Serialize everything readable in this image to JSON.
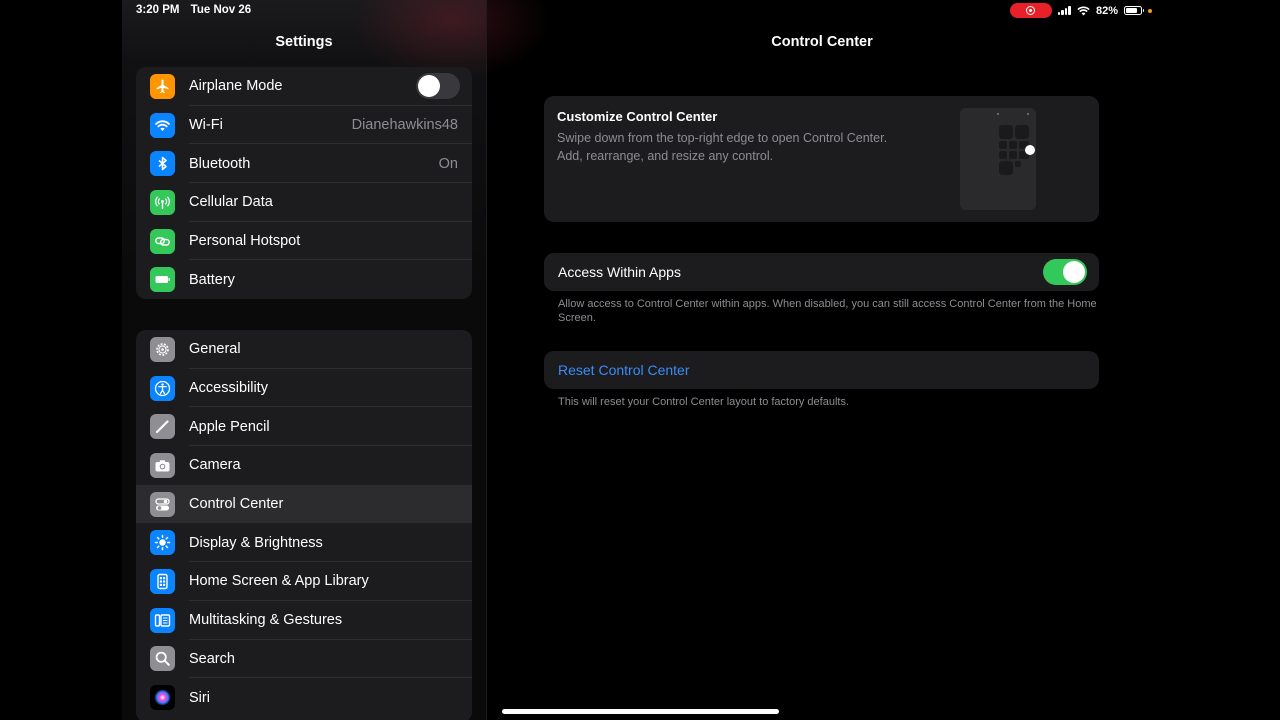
{
  "status": {
    "time": "3:20 PM",
    "date": "Tue Nov 26",
    "battery_percent": "82%",
    "battery_level": 0.82,
    "recording": true
  },
  "sidebar": {
    "title": "Settings",
    "group1": [
      {
        "label": "Airplane Mode",
        "icon": "airplane-icon",
        "color": "#ff9500",
        "toggle": false
      },
      {
        "label": "Wi-Fi",
        "icon": "wifi-icon",
        "color": "#0a84ff",
        "value": "Dianehawkins48"
      },
      {
        "label": "Bluetooth",
        "icon": "bluetooth-icon",
        "color": "#0a84ff",
        "value": "On"
      },
      {
        "label": "Cellular Data",
        "icon": "antenna-icon",
        "color": "#34c759"
      },
      {
        "label": "Personal Hotspot",
        "icon": "link-icon",
        "color": "#34c759"
      },
      {
        "label": "Battery",
        "icon": "battery-icon",
        "color": "#34c759"
      }
    ],
    "group2": [
      {
        "label": "General",
        "icon": "gear-icon",
        "color": "#8e8e93"
      },
      {
        "label": "Accessibility",
        "icon": "accessibility-icon",
        "color": "#0a84ff"
      },
      {
        "label": "Apple Pencil",
        "icon": "pencil-icon",
        "color": "#8e8e93"
      },
      {
        "label": "Camera",
        "icon": "camera-icon",
        "color": "#8e8e93"
      },
      {
        "label": "Control Center",
        "icon": "switches-icon",
        "color": "#8e8e93",
        "selected": true
      },
      {
        "label": "Display & Brightness",
        "icon": "sun-icon",
        "color": "#0a84ff"
      },
      {
        "label": "Home Screen & App Library",
        "icon": "home-screen-icon",
        "color": "#0a84ff"
      },
      {
        "label": "Multitasking & Gestures",
        "icon": "multitasking-icon",
        "color": "#0a84ff"
      },
      {
        "label": "Search",
        "icon": "search-icon",
        "color": "#8e8e93"
      },
      {
        "label": "Siri",
        "icon": "siri-icon",
        "color": "#000000"
      }
    ]
  },
  "detail": {
    "title": "Control Center",
    "customize_title": "Customize Control Center",
    "customize_desc": "Swipe down from the top-right edge to open Control Center. Add, rearrange, and resize any control.",
    "access_label": "Access Within Apps",
    "access_enabled": true,
    "access_footer": "Allow access to Control Center within apps. When disabled, you can still access Control Center from the Home Screen.",
    "reset_label": "Reset Control Center",
    "reset_footer": "This will reset your Control Center layout to factory defaults.",
    "accent_color": "#3b8cf7",
    "toggle_on_color": "#34c759"
  }
}
